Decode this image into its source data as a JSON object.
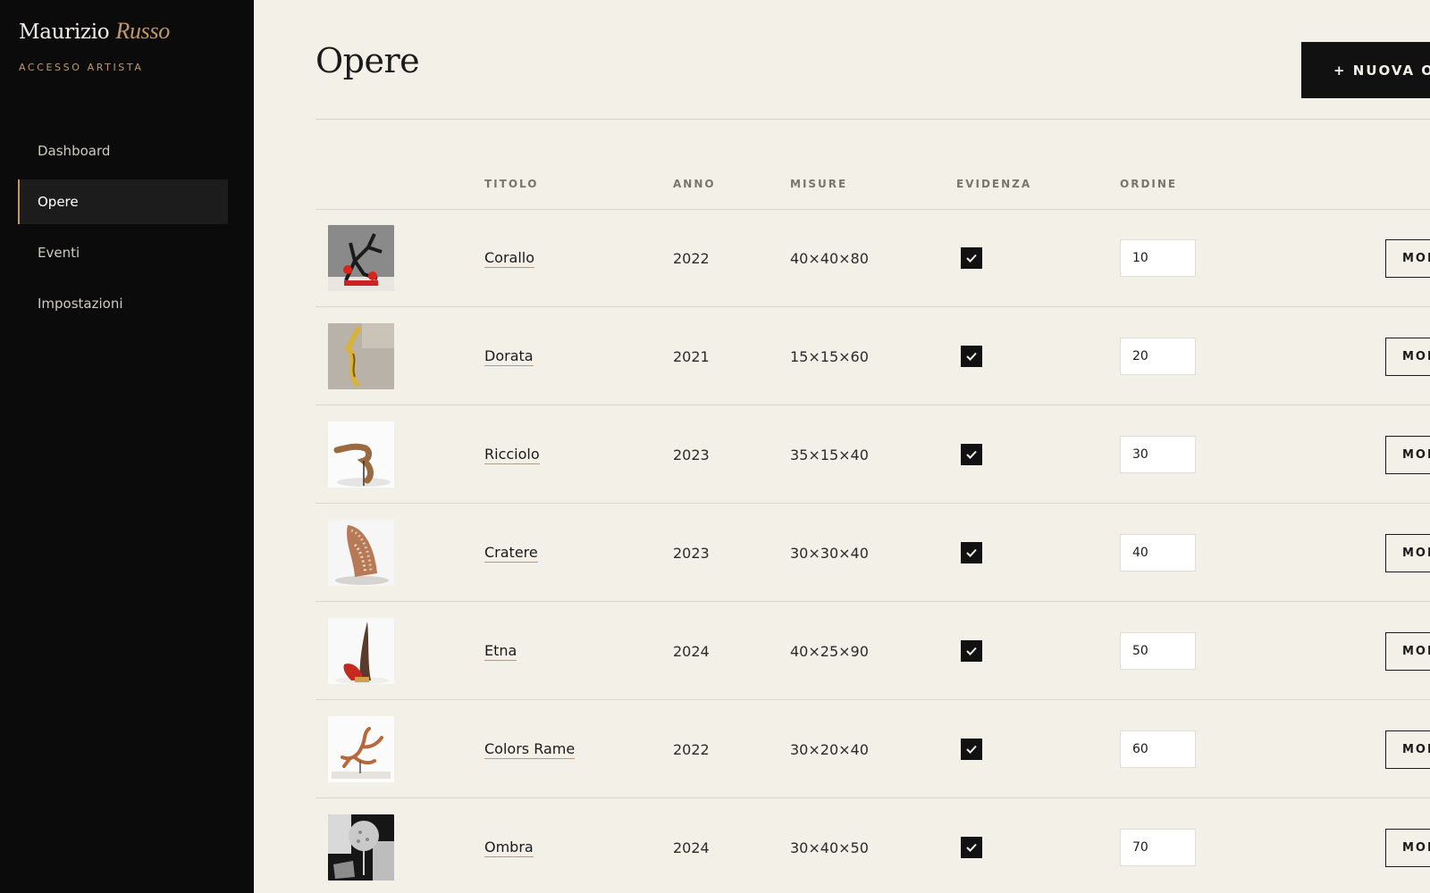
{
  "sidebar": {
    "brand_first": "Maurizio",
    "brand_last": "Russo",
    "brand_sub": "ACCESSO ARTISTA",
    "items": [
      {
        "label": "Dashboard",
        "active": false
      },
      {
        "label": "Opere",
        "active": true
      },
      {
        "label": "Eventi",
        "active": false
      },
      {
        "label": "Impostazioni",
        "active": false
      }
    ]
  },
  "header": {
    "title": "Opere",
    "new_button": "+ NUOVA OPERA"
  },
  "table": {
    "columns": {
      "titolo": "TITOLO",
      "anno": "ANNO",
      "misure": "MISURE",
      "evidenza": "EVIDENZA",
      "ordine": "ORDINE"
    },
    "edit_label": "MODIFICA",
    "rows": [
      {
        "title": "Corallo",
        "year": "2022",
        "size": "40×40×80",
        "featured": true,
        "order": "10"
      },
      {
        "title": "Dorata",
        "year": "2021",
        "size": "15×15×60",
        "featured": true,
        "order": "20"
      },
      {
        "title": "Ricciolo",
        "year": "2023",
        "size": "35×15×40",
        "featured": true,
        "order": "30"
      },
      {
        "title": "Cratere",
        "year": "2023",
        "size": "30×30×40",
        "featured": true,
        "order": "40"
      },
      {
        "title": "Etna",
        "year": "2024",
        "size": "40×25×90",
        "featured": true,
        "order": "50"
      },
      {
        "title": "Colors Rame",
        "year": "2022",
        "size": "30×20×40",
        "featured": true,
        "order": "60"
      },
      {
        "title": "Ombra",
        "year": "2024",
        "size": "30×40×50",
        "featured": true,
        "order": "70"
      }
    ]
  },
  "colors": {
    "accent": "#c39a67",
    "sidebar_bg": "#0b0b0b",
    "page_bg": "#f3f0e8"
  }
}
